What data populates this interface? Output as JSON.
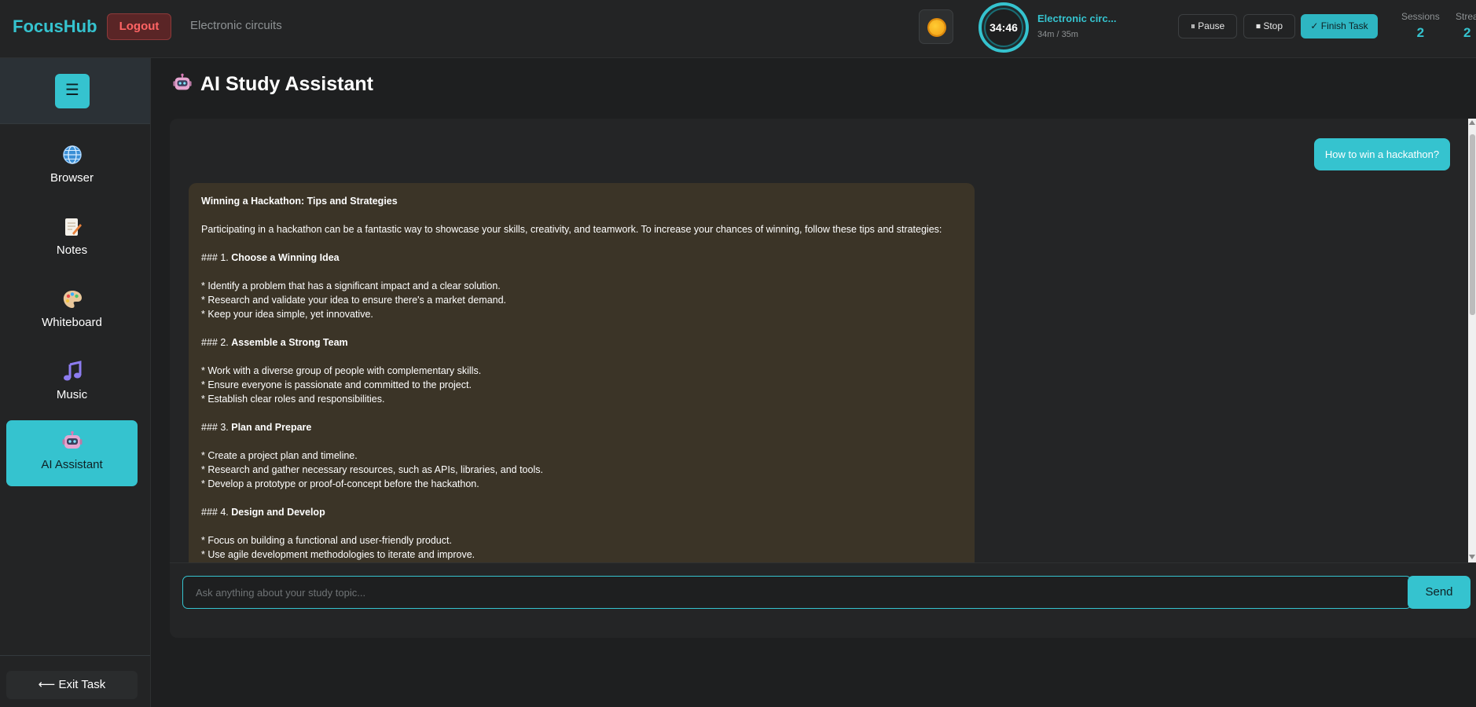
{
  "header": {
    "brand": "FocusHub",
    "logout_label": "Logout",
    "task_name": "Electronic circuits",
    "timer": {
      "time": "34:46",
      "task": "Electronic circ...",
      "progress": "34m / 35m",
      "progress_fraction": 0.97
    },
    "controls": {
      "pause_label": "⏸ Pause",
      "stop_label": "⏹ Stop",
      "finish_label": "✓ Finish Task"
    },
    "stats": [
      {
        "label": "Sessions",
        "value": "2"
      },
      {
        "label": "Strea",
        "value": "2"
      }
    ]
  },
  "sidebar": {
    "menu_icon": "☰",
    "items": [
      {
        "label": "Browser",
        "icon": "globe-icon",
        "active": false
      },
      {
        "label": "Notes",
        "icon": "notepad-icon",
        "active": false
      },
      {
        "label": "Whiteboard",
        "icon": "palette-icon",
        "active": false
      },
      {
        "label": "Music",
        "icon": "music-note-icon",
        "active": false
      },
      {
        "label": "AI Assistant",
        "icon": "robot-icon",
        "active": true
      }
    ],
    "exit_label": "⟵ Exit Task"
  },
  "main": {
    "title": "AI Study Assistant",
    "user_message": "How to win a hackathon?",
    "ai_message": {
      "heading": "Winning a Hackathon: Tips and Strategies",
      "intro": "Participating in a hackathon can be a fantastic way to showcase your skills, creativity, and teamwork. To increase your chances of winning, follow these tips and strategies:",
      "sections": [
        {
          "prefix": "### 1. ",
          "title": "Choose a Winning Idea",
          "bullets": [
            "* Identify a problem that has a significant impact and a clear solution.",
            "* Research and validate your idea to ensure there's a market demand.",
            "* Keep your idea simple, yet innovative."
          ]
        },
        {
          "prefix": "### 2. ",
          "title": "Assemble a Strong Team",
          "bullets": [
            "* Work with a diverse group of people with complementary skills.",
            "* Ensure everyone is passionate and committed to the project.",
            "* Establish clear roles and responsibilities."
          ]
        },
        {
          "prefix": "### 3. ",
          "title": "Plan and Prepare",
          "bullets": [
            "* Create a project plan and timeline.",
            "* Research and gather necessary resources, such as APIs, libraries, and tools.",
            "* Develop a prototype or proof-of-concept before the hackathon."
          ]
        },
        {
          "prefix": "### 4. ",
          "title": "Design and Develop",
          "bullets": [
            "* Focus on building a functional and user-friendly product.",
            "* Use agile development methodologies to iterate and improve."
          ]
        }
      ]
    },
    "input_placeholder": "Ask anything about your study topic...",
    "send_label": "Send"
  },
  "colors": {
    "accent": "#35c3cf",
    "logout": "#ff6464",
    "ai_bubble": "#3b3427"
  }
}
